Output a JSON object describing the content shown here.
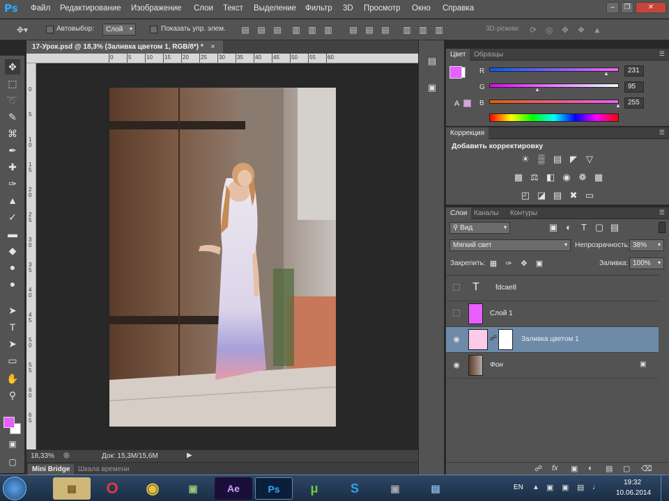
{
  "menubar": {
    "logo": "Ps",
    "items": [
      "Файл",
      "Редактирование",
      "Изображение",
      "Слои",
      "Текст",
      "Выделение",
      "Фильтр",
      "3D",
      "Просмотр",
      "Окно",
      "Справка"
    ]
  },
  "options": {
    "autoselect_label": "Автовыбор:",
    "autoselect_value": "Слой",
    "show_transform_label": "Показать упр. элем.",
    "mode_3d_label": "3D-режим:"
  },
  "document": {
    "tab_title": "17-Урок.psd @ 18,3% (Заливка цветом 1, RGB/8*) *",
    "zoom": "18,33%",
    "doc_info": "Док: 15,3М/15,6М",
    "hruler_ticks": [
      "0",
      "5",
      "10",
      "15",
      "20",
      "25",
      "30",
      "35",
      "40",
      "45",
      "50",
      "55",
      "60"
    ],
    "vruler_ticks": [
      "0",
      "5",
      "1\n0",
      "1\n5",
      "2\n0",
      "2\n5",
      "3\n0",
      "3\n5",
      "4\n0",
      "4\n5",
      "5\n0",
      "5\n5",
      "6\n0",
      "6\n5"
    ]
  },
  "bottom_tabs": [
    "Mini Bridge",
    "Шкала времени"
  ],
  "color_panel": {
    "tabs": [
      "Цвет",
      "Образцы"
    ],
    "fg_color": "#e75fff",
    "channels": [
      {
        "label": "R",
        "value": "231"
      },
      {
        "label": "G",
        "value": "95"
      },
      {
        "label": "B",
        "value": "255"
      }
    ]
  },
  "adjustments_panel": {
    "tabs": [
      "Коррекция"
    ],
    "heading": "Добавить корректировку"
  },
  "layers_panel": {
    "tabs": [
      "Слои",
      "Каналы",
      "Контуры"
    ],
    "filter_value": "Вид",
    "blend_mode": "Мягкий свет",
    "opacity_label": "Непрозрачность:",
    "opacity_value": "38%",
    "lock_label": "Закрепить:",
    "fill_label": "Заливка:",
    "fill_value": "100%",
    "layers": [
      {
        "name": "fdcae8",
        "kind": "text",
        "visible": false
      },
      {
        "name": "Слой 1",
        "kind": "color",
        "visible": false,
        "color": "#e75fff"
      },
      {
        "name": "Заливка цветом 1",
        "kind": "fill",
        "visible": true,
        "selected": true,
        "color": "#fdcae8"
      },
      {
        "name": "Фон",
        "kind": "photo",
        "visible": true,
        "locked": true
      }
    ]
  },
  "taskbar": {
    "lang": "EN",
    "time": "19:32",
    "date": "10.06.2014",
    "apps": [
      "Ae",
      "Ps"
    ]
  }
}
